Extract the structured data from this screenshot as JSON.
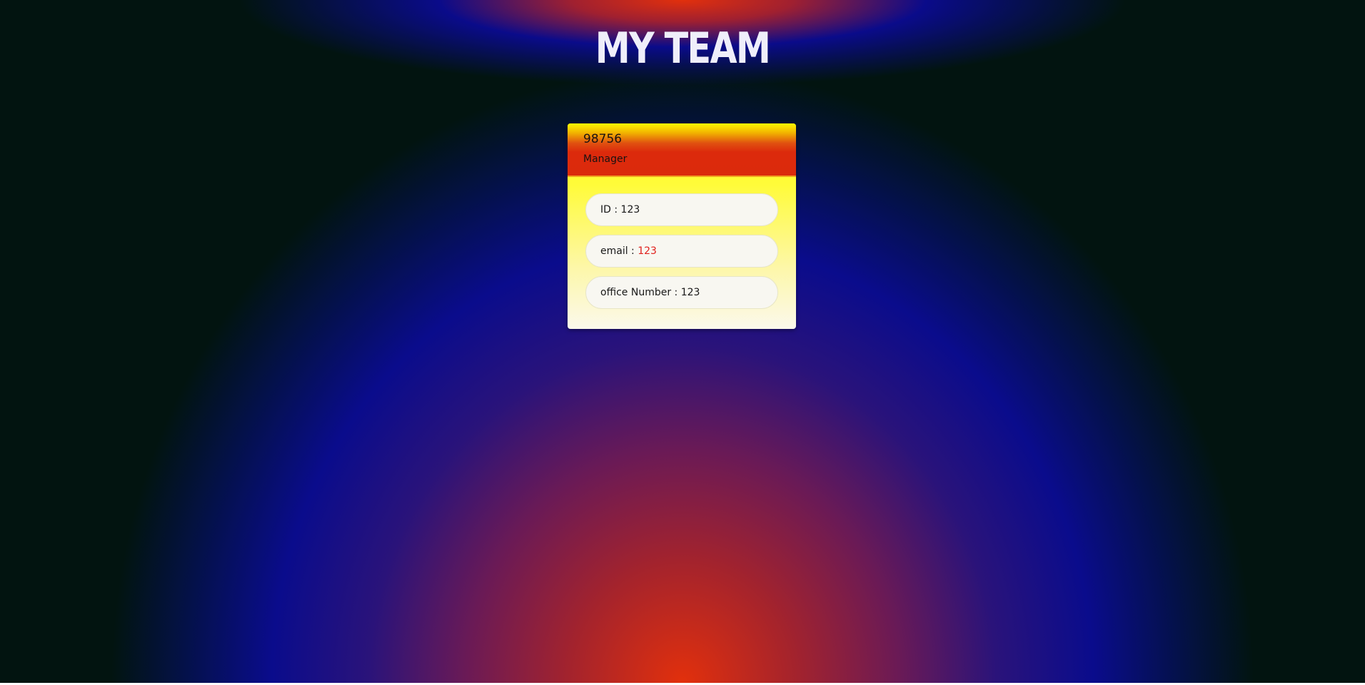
{
  "page": {
    "title": "MY TEAM"
  },
  "colors": {
    "accent_red": "#dc2a0c",
    "accent_yellow": "#fffd12",
    "link_red": "#e0201c",
    "background_dark": "#021410",
    "glow_blue": "#0a0c8c"
  },
  "team": {
    "cards": [
      {
        "name": "98756",
        "role": "Manager",
        "id_label": "ID : ",
        "id_value": "123",
        "email_label": "email : ",
        "email_value": "123",
        "office_label": "office Number : ",
        "office_value": "123"
      }
    ]
  }
}
